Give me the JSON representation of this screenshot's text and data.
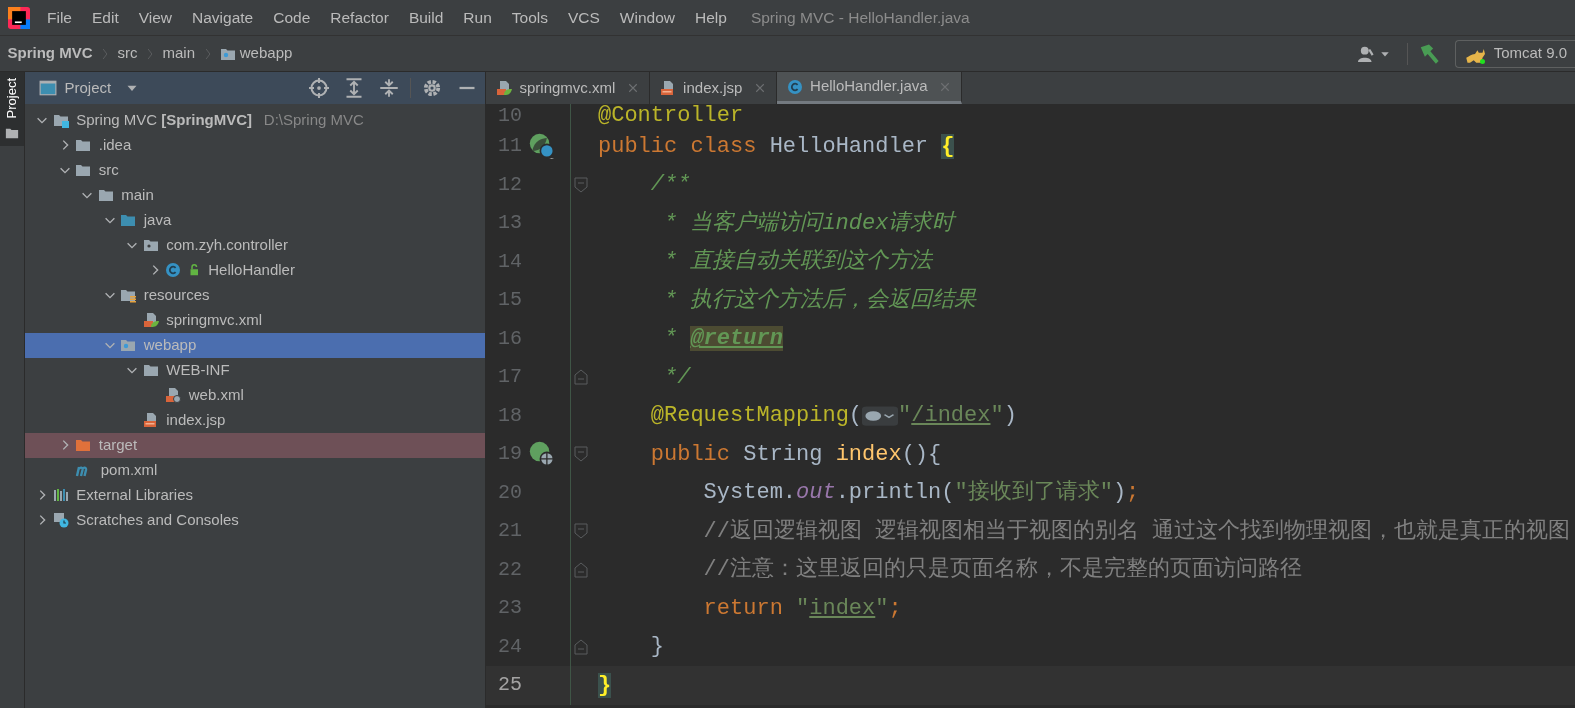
{
  "window": {
    "title": "Spring MVC - HelloHandler.java"
  },
  "menu": [
    "File",
    "Edit",
    "View",
    "Navigate",
    "Code",
    "Refactor",
    "Build",
    "Run",
    "Tools",
    "VCS",
    "Window",
    "Help"
  ],
  "breadcrumbs": [
    {
      "label": "Spring MVC",
      "kind": "project"
    },
    {
      "label": "src",
      "kind": "folder"
    },
    {
      "label": "main",
      "kind": "folder"
    },
    {
      "label": "webapp",
      "kind": "webapp"
    }
  ],
  "toolbar": {
    "run_config": "Tomcat 9.0"
  },
  "tool_stripe": [
    {
      "label": "Project",
      "selected": true
    }
  ],
  "project_panel": {
    "title": "Project",
    "tree": [
      {
        "label": "Spring MVC **[SpringMVC]**",
        "path": "D:\\Spring MVC",
        "kind": "module",
        "expanded": true,
        "selected": false,
        "excluded": false,
        "children": [
          {
            "label": ".idea",
            "kind": "folder",
            "expanded": false,
            "selected": false,
            "excluded": false
          },
          {
            "label": "src",
            "kind": "folder",
            "expanded": true,
            "selected": false,
            "excluded": false,
            "children": [
              {
                "label": "main",
                "kind": "folder",
                "expanded": true,
                "selected": false,
                "excluded": false,
                "children": [
                  {
                    "label": "java",
                    "kind": "source",
                    "expanded": true,
                    "selected": false,
                    "excluded": false,
                    "children": [
                      {
                        "label": "com.zyh.controller",
                        "kind": "package",
                        "expanded": true,
                        "selected": false,
                        "excluded": false,
                        "children": [
                          {
                            "label": "HelloHandler",
                            "kind": "class",
                            "expanded": false,
                            "selected": false,
                            "excluded": false
                          }
                        ]
                      }
                    ]
                  },
                  {
                    "label": "resources",
                    "kind": "resources",
                    "expanded": true,
                    "selected": false,
                    "excluded": false,
                    "children": [
                      {
                        "label": "springmvc.xml",
                        "kind": "xml-spring",
                        "selected": false,
                        "excluded": false
                      }
                    ]
                  },
                  {
                    "label": "webapp",
                    "kind": "webapp",
                    "expanded": true,
                    "selected": true,
                    "excluded": false,
                    "children": [
                      {
                        "label": "WEB-INF",
                        "kind": "folder",
                        "expanded": true,
                        "selected": false,
                        "excluded": false,
                        "children": [
                          {
                            "label": "web.xml",
                            "kind": "xml-web",
                            "selected": false,
                            "excluded": false
                          }
                        ]
                      },
                      {
                        "label": "index.jsp",
                        "kind": "jsp",
                        "selected": false,
                        "excluded": false
                      }
                    ]
                  }
                ]
              }
            ]
          },
          {
            "label": "target",
            "kind": "excluded-folder",
            "expanded": false,
            "selected": false,
            "excluded": true
          },
          {
            "label": "pom.xml",
            "kind": "maven",
            "selected": false,
            "excluded": false
          }
        ]
      },
      {
        "label": "External Libraries",
        "kind": "libraries",
        "expanded": false,
        "selected": false,
        "excluded": false
      },
      {
        "label": "Scratches and Consoles",
        "kind": "scratches",
        "expanded": false,
        "selected": false,
        "excluded": false
      }
    ]
  },
  "editor": {
    "tabs": [
      {
        "label": "springmvc.xml",
        "kind": "xml-spring",
        "selected": false
      },
      {
        "label": "index.jsp",
        "kind": "jsp",
        "selected": false
      },
      {
        "label": "HelloHandler.java",
        "kind": "class",
        "selected": true
      }
    ],
    "lines": [
      {
        "number": "10",
        "current": false,
        "tokens": [
          {
            "kind": "annotation",
            "text": "@Controller"
          }
        ]
      },
      {
        "number": "11",
        "current": false,
        "gutter_icon": {
          "kind": "bean"
        },
        "tokens": [
          {
            "kind": "keyword",
            "text": "public class"
          },
          {
            "kind": "plain",
            "text": " HelloHandler "
          },
          {
            "kind": "brace-match",
            "text": "{"
          }
        ]
      },
      {
        "number": "12",
        "current": false,
        "fold": {
          "kind": "start"
        },
        "tokens": [
          {
            "kind": "doc",
            "text": "    /**"
          }
        ]
      },
      {
        "number": "13",
        "current": false,
        "tokens": [
          {
            "kind": "doc",
            "text": "     * 当客户端访问index请求时"
          }
        ]
      },
      {
        "number": "14",
        "current": false,
        "tokens": [
          {
            "kind": "doc",
            "text": "     * 直接自动关联到这个方法"
          }
        ]
      },
      {
        "number": "15",
        "current": false,
        "tokens": [
          {
            "kind": "doc",
            "text": "     * 执行这个方法后，会返回结果"
          }
        ]
      },
      {
        "number": "16",
        "current": false,
        "tokens": [
          {
            "kind": "doc",
            "text": "     * "
          },
          {
            "kind": "doc-tag",
            "text": "@return"
          }
        ]
      },
      {
        "number": "17",
        "current": false,
        "fold": {
          "kind": "end"
        },
        "tokens": [
          {
            "kind": "doc",
            "text": "     */"
          }
        ]
      },
      {
        "number": "18",
        "current": false,
        "tokens": [
          {
            "kind": "annotation",
            "text": "    @RequestMapping"
          },
          {
            "kind": "plain",
            "text": "("
          },
          {
            "kind": "inlay"
          },
          {
            "kind": "string",
            "text": "\""
          },
          {
            "kind": "link",
            "text": "/index"
          },
          {
            "kind": "string",
            "text": "\""
          },
          {
            "kind": "plain",
            "text": ")"
          }
        ]
      },
      {
        "number": "19",
        "current": false,
        "gutter_icon": {
          "kind": "mapping"
        },
        "fold": {
          "kind": "start"
        },
        "tokens": [
          {
            "kind": "keyword",
            "text": "    public"
          },
          {
            "kind": "plain",
            "text": " String "
          },
          {
            "kind": "method",
            "text": "index"
          },
          {
            "kind": "plain",
            "text": "(){"
          }
        ]
      },
      {
        "number": "20",
        "current": false,
        "tokens": [
          {
            "kind": "plain",
            "text": "        System."
          },
          {
            "kind": "field",
            "text": "out"
          },
          {
            "kind": "plain",
            "text": ".println("
          },
          {
            "kind": "string",
            "text": "\"接收到了请求\""
          },
          {
            "kind": "plain",
            "text": ")"
          },
          {
            "kind": "keyword",
            "text": ";"
          }
        ]
      },
      {
        "number": "21",
        "current": false,
        "fold": {
          "kind": "start"
        },
        "tokens": [
          {
            "kind": "comment",
            "text": "        //返回逻辑视图 逻辑视图相当于视图的别名 通过这个找到物理视图，也就是真正的视图"
          }
        ]
      },
      {
        "number": "22",
        "current": false,
        "fold": {
          "kind": "end"
        },
        "tokens": [
          {
            "kind": "comment",
            "text": "        //注意：这里返回的只是页面名称，不是完整的页面访问路径"
          }
        ]
      },
      {
        "number": "23",
        "current": false,
        "tokens": [
          {
            "kind": "keyword",
            "text": "        return"
          },
          {
            "kind": "string",
            "text": " \""
          },
          {
            "kind": "link",
            "text": "index"
          },
          {
            "kind": "string",
            "text": "\""
          },
          {
            "kind": "keyword",
            "text": ";"
          }
        ]
      },
      {
        "number": "24",
        "current": false,
        "fold": {
          "kind": "end"
        },
        "tokens": [
          {
            "kind": "plain",
            "text": "    }"
          }
        ]
      },
      {
        "number": "25",
        "current": true,
        "tokens": [
          {
            "kind": "brace-match",
            "text": "}"
          }
        ]
      }
    ]
  }
}
